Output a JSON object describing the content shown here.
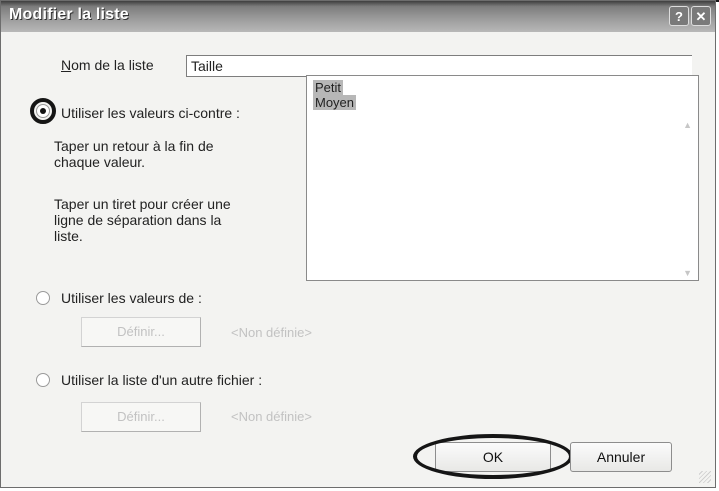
{
  "window": {
    "title": "Modifier la liste",
    "help_glyph": "?",
    "close_glyph": "✕"
  },
  "name_field": {
    "label": "Nom de la liste",
    "value": "Taille"
  },
  "option_values": {
    "label": "Utiliser les valeurs ci-contre :",
    "selected": true,
    "hint1": [
      "Taper un retour à la fin de",
      "chaque valeur."
    ],
    "hint2": [
      "Taper un tiret pour créer une",
      "ligne de séparation dans la",
      "liste."
    ]
  },
  "list_values": [
    "Petit",
    "Moyen"
  ],
  "option_from": {
    "label": "Utiliser les valeurs de :",
    "selected": false,
    "define_button": "Définir...",
    "status": "<Non définie>"
  },
  "option_other_file": {
    "label": "Utiliser la liste d'un autre fichier :",
    "selected": false,
    "define_button": "Définir...",
    "status": "<Non définie>"
  },
  "footer": {
    "ok_label": "OK",
    "cancel_label": "Annuler"
  },
  "icons": {
    "help": "help-icon",
    "close": "close-icon",
    "scroll_up": "scroll-up-icon",
    "scroll_down": "scroll-down-icon",
    "resize": "resize-grip-icon"
  }
}
